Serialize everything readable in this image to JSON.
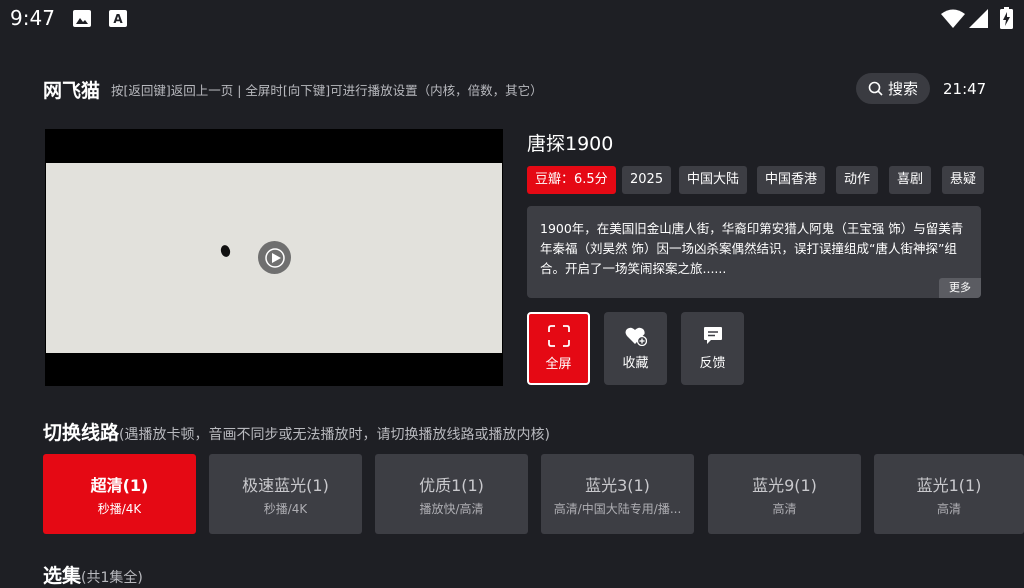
{
  "status_bar": {
    "time": "9:47",
    "icons": [
      "image-icon",
      "text-a-icon",
      "wifi-icon",
      "signal-icon",
      "battery-icon"
    ]
  },
  "header": {
    "title": "网飞猫",
    "hint": "按[返回键]返回上一页 | 全屏时[向下键]可进行播放设置（内核，倍数，其它）",
    "search_label": "搜索",
    "clock": "21:47"
  },
  "movie": {
    "title": "唐探1900",
    "tags": [
      "豆瓣：6.5分",
      "2025",
      "中国大陆",
      "中国香港",
      "动作",
      "喜剧",
      "悬疑"
    ],
    "description": "1900年，在美国旧金山唐人街，华裔印第安猎人阿鬼（王宝强 饰）与留美青年秦福（刘昊然 饰）因一场凶杀案偶然结识，误打误撞组成“唐人街神探”组合。开启了一场笑闹探案之旅......",
    "more_label": "更多"
  },
  "actions": [
    {
      "label": "全屏",
      "icon": "fullscreen-icon",
      "active": true
    },
    {
      "label": "收藏",
      "icon": "heart-add-icon",
      "active": false
    },
    {
      "label": "反馈",
      "icon": "feedback-icon",
      "active": false
    }
  ],
  "routes_section": {
    "title": "切换线路",
    "hint": "(遇播放卡顿，音画不同步或无法播放时，请切换播放线路或播放内核)"
  },
  "routes": [
    {
      "name": "超清(1)",
      "sub": "秒播/4K",
      "active": true
    },
    {
      "name": "极速蓝光(1)",
      "sub": "秒播/4K",
      "active": false
    },
    {
      "name": "优质1(1)",
      "sub": "播放快/高清",
      "active": false
    },
    {
      "name": "蓝光3(1)",
      "sub": "高清/中国大陆专用/播...",
      "active": false
    },
    {
      "name": "蓝光9(1)",
      "sub": "高清",
      "active": false
    },
    {
      "name": "蓝光1(1)",
      "sub": "高清",
      "active": false
    }
  ],
  "episodes_section": {
    "title": "选集",
    "hint": "(共1集全)"
  },
  "colors": {
    "background": "#1e1f24",
    "accent": "#e50914",
    "card": "#3d3e44"
  }
}
